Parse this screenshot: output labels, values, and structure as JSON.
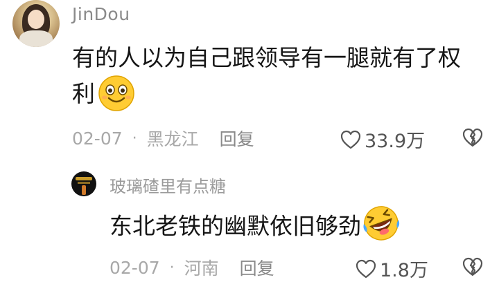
{
  "comment": {
    "username": "JinDou",
    "text": "有的人以为自己跟领导有一腿就有了权利",
    "emoji": "smiling-face-icon",
    "date": "02-07",
    "separator": "·",
    "location": "黑龙江",
    "reply_label": "回复",
    "likes": "33.9万"
  },
  "reply": {
    "username": "玻璃碴里有点糖",
    "text": "东北老铁的幽默依旧够劲",
    "emoji": "rolling-laughing-face-icon",
    "date": "02-07",
    "separator": "·",
    "location": "河南",
    "reply_label": "回复",
    "likes": "1.8万"
  }
}
